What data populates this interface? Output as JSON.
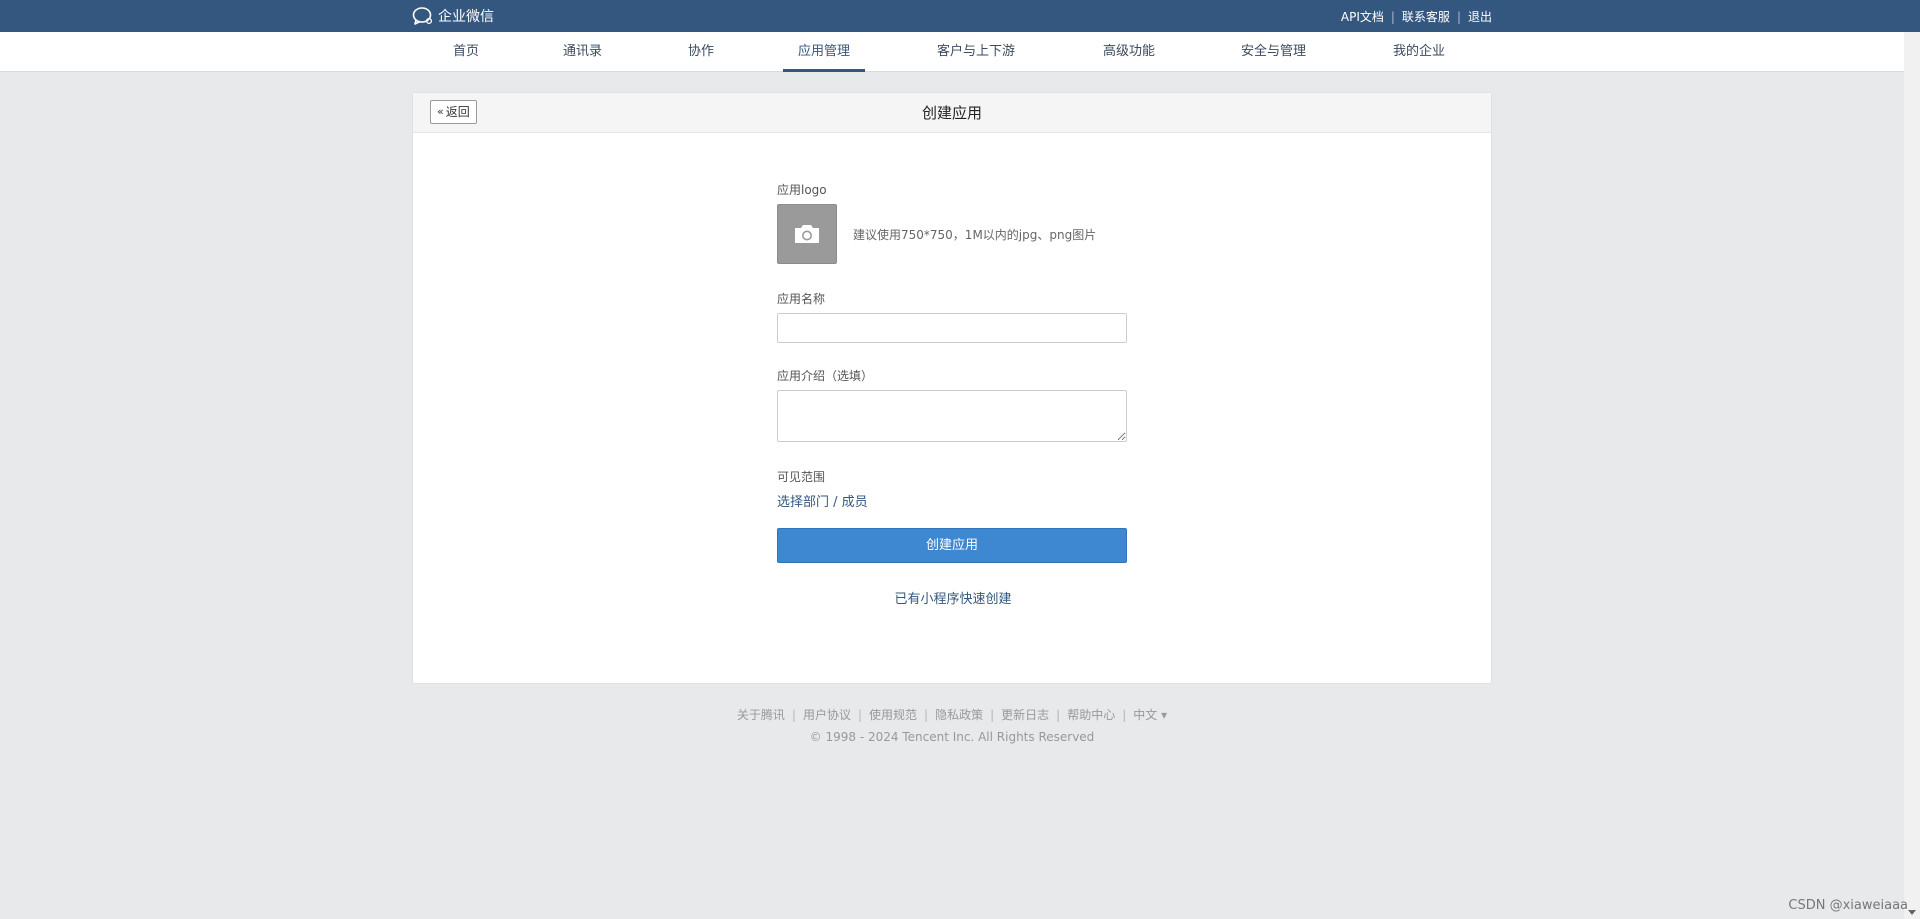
{
  "brand": {
    "name": "企业微信",
    "icon": "chat-bubble-icon"
  },
  "top_links": [
    "API文档",
    "联系客服",
    "退出"
  ],
  "nav": {
    "items": [
      "首页",
      "通讯录",
      "协作",
      "应用管理",
      "客户与上下游",
      "高级功能",
      "安全与管理",
      "我的企业"
    ],
    "active": "应用管理"
  },
  "card": {
    "back_label": "返回",
    "title": "创建应用"
  },
  "form": {
    "logo_label": "应用logo",
    "logo_hint": "建议使用750*750，1M以内的jpg、png图片",
    "logo_icon": "camera-icon",
    "name_label": "应用名称",
    "name_value": "",
    "intro_label": "应用介绍（选填）",
    "intro_value": "",
    "range_label": "可见范围",
    "range_link": "选择部门 / 成员",
    "create_button": "创建应用",
    "mini_program_link": "已有小程序快速创建"
  },
  "footer": {
    "links": [
      "关于腾讯",
      "用户协议",
      "使用规范",
      "隐私政策",
      "更新日志",
      "帮助中心",
      "中文 ▾"
    ],
    "copyright": "© 1998 - 2024 Tencent Inc. All Rights Reserved"
  },
  "watermark": "CSDN @xiaweiaaa",
  "colors": {
    "topbar": "#34577f",
    "primary_button": "#3e87d1",
    "link": "#34577f",
    "background": "#e8e9eb"
  }
}
